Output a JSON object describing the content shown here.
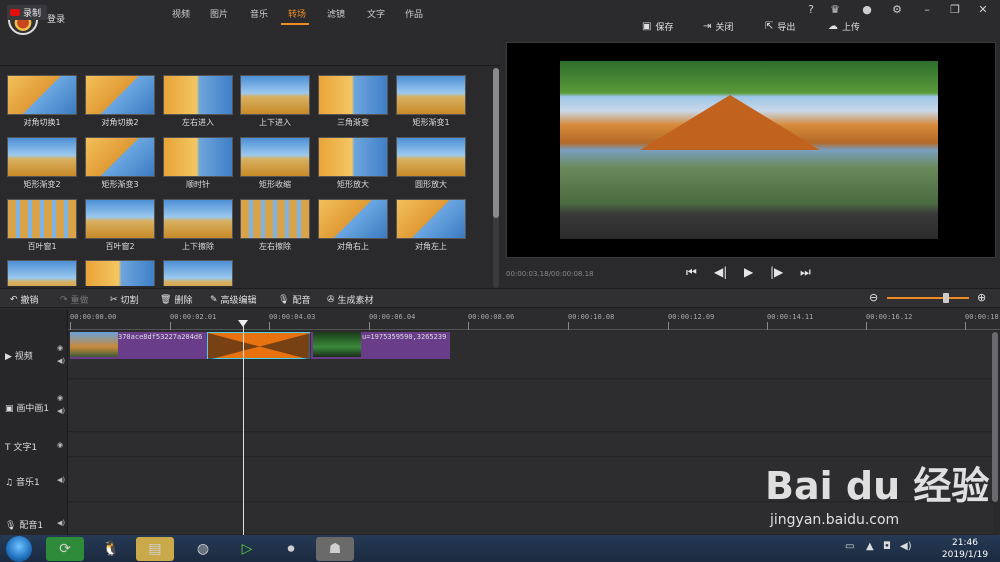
{
  "header": {
    "login": "登录",
    "save": "保存",
    "close": "关闭",
    "export": "导出",
    "upload": "上传",
    "help": "?",
    "vip": "VIP"
  },
  "tabs": {
    "record": "录制",
    "items": [
      "视频",
      "图片",
      "音乐",
      "转场",
      "滤镜",
      "文字",
      "作品"
    ],
    "active": "转场"
  },
  "transitions": [
    "对角切换1",
    "对角切换2",
    "左右进入",
    "上下进入",
    "三角渐变",
    "矩形渐变1",
    "矩形渐变2",
    "矩形渐变3",
    "顺时针",
    "矩形收缩",
    "矩形放大",
    "圆形放大",
    "百叶窗1",
    "百叶窗2",
    "上下擦除",
    "左右擦除",
    "对角右上",
    "对角左上"
  ],
  "preview": {
    "timecode": "00:00:03.18/00:00:08.18"
  },
  "edit_toolbar": {
    "undo": "撤销",
    "redo": "重做",
    "cut": "切割",
    "delete": "删除",
    "advanced": "高级编辑",
    "dub": "配音",
    "generate": "生成素材"
  },
  "ruler": [
    "00:00:00.00",
    "00:00:02.01",
    "00:00:04.03",
    "00:00:06.04",
    "00:00:08.06",
    "00:00:10.08",
    "00:00:12.09",
    "00:00:14.11",
    "00:00:16.12",
    "00:00:18."
  ],
  "tracks": {
    "video": "视频",
    "pip": "画中画1",
    "text": "文字1",
    "music": "音乐1",
    "voice": "配音1"
  },
  "clips": {
    "clip1": "370ace8df53227a204d6",
    "clip2": "u=1975359590,3265239"
  },
  "taskbar": {
    "time": "21:46",
    "date": "2019/1/19"
  },
  "watermark": {
    "main": "Bai du 经验",
    "url": "jingyan.baidu.com"
  },
  "colors": {
    "accent": "#f08a24",
    "clip": "#6a3d8a"
  }
}
